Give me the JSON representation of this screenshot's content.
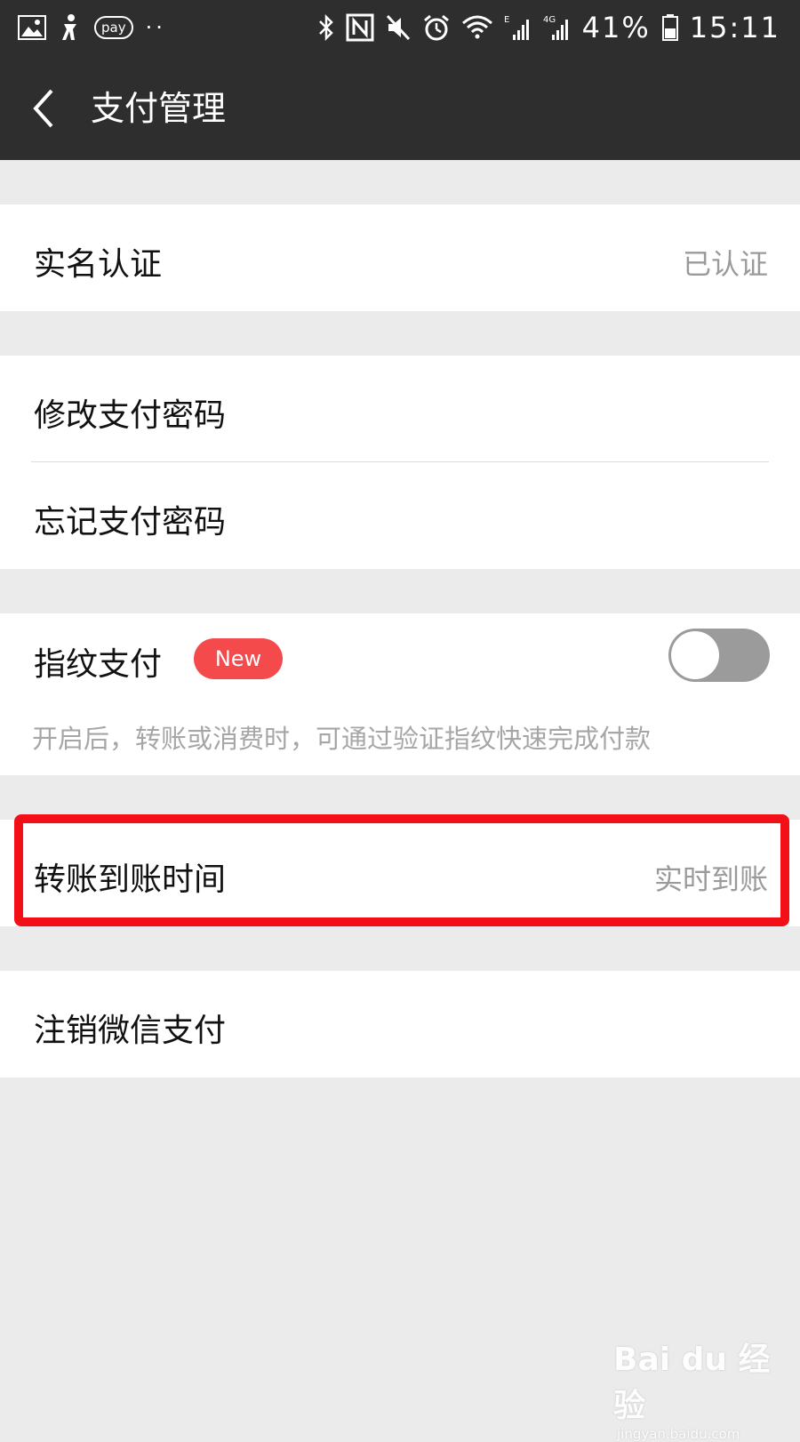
{
  "status_bar": {
    "icons_left": [
      "image-icon",
      "accessibility-icon",
      "pay-icon",
      "more-dots-icon"
    ],
    "pay_label": "pay",
    "dots": "··",
    "icons_right": [
      "bluetooth-icon",
      "nfc-icon",
      "mute-icon",
      "alarm-icon",
      "wifi-icon",
      "signal-e-icon",
      "signal-4g-icon",
      "battery-icon"
    ],
    "battery_text": "41%",
    "time": "15:11"
  },
  "header": {
    "title": "支付管理"
  },
  "settings": {
    "real_name": {
      "label": "实名认证",
      "value": "已认证"
    },
    "change_password": {
      "label": "修改支付密码"
    },
    "forgot_password": {
      "label": "忘记支付密码"
    },
    "fingerprint": {
      "label": "指纹支付",
      "badge": "New",
      "enabled": false,
      "description": "开启后，转账或消费时，可通过验证指纹快速完成付款"
    },
    "transfer_time": {
      "label": "转账到账时间",
      "value": "实时到账"
    },
    "cancel_wechat_pay": {
      "label": "注销微信支付"
    }
  },
  "watermark": {
    "brand": "Bai du 经验",
    "url": "jingyan.baidu.com"
  },
  "colors": {
    "dark_bar": "#2e2e2e",
    "background": "#ebebeb",
    "badge_red": "#f44a4c",
    "highlight_red": "#f30f17"
  }
}
